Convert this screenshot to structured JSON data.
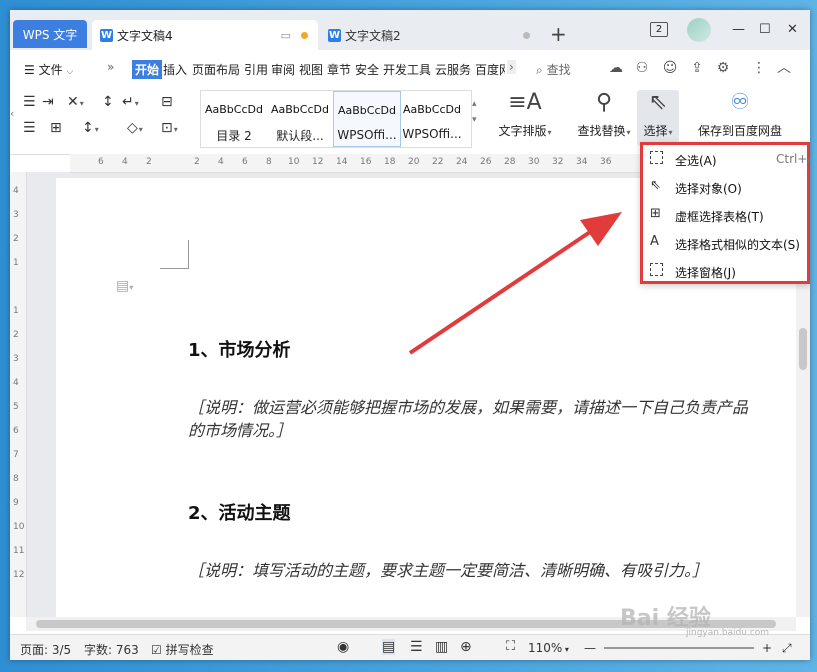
{
  "tabs": {
    "app": "WPS 文字",
    "active_doc": "文字文稿4",
    "inactive_doc": "文字文稿2",
    "add": "+",
    "window_badge": "2"
  },
  "menubar": {
    "file": "文件",
    "items": [
      "开始",
      "插入",
      "页面布局",
      "引用",
      "审阅",
      "视图",
      "章节",
      "安全",
      "开发工具",
      "云服务",
      "百度网"
    ],
    "active_item": "开始",
    "search": "查找"
  },
  "ribbon": {
    "styles": [
      {
        "sample": "AaBbCcDd",
        "name": "目录 2"
      },
      {
        "sample": "AaBbCcDd",
        "name": "默认段..."
      },
      {
        "sample": "AaBbCcDd",
        "name": "WPSOffi..."
      },
      {
        "sample": "AaBbCcDd",
        "name": "WPSOffi..."
      }
    ],
    "text_layout": "文字排版",
    "find_replace": "查找替换",
    "select": "选择",
    "save_baidu": "保存到百度网盘"
  },
  "select_menu": {
    "items": [
      {
        "label": "全选(A)",
        "shortcut": "Ctrl+A",
        "icon": "select-all-icon"
      },
      {
        "label": "选择对象(O)",
        "shortcut": "",
        "icon": "cursor-icon"
      },
      {
        "label": "虚框选择表格(T)",
        "shortcut": "",
        "icon": "table-select-icon"
      },
      {
        "label": "选择格式相似的文本(S)",
        "shortcut": "",
        "icon": "similar-format-icon"
      },
      {
        "label": "选择窗格(J)",
        "shortcut": "",
        "icon": "selection-pane-icon"
      }
    ]
  },
  "document": {
    "heading1": "1、市场分析",
    "note1_line1": "［说明：做运营必须能够把握市场的发展，如果需要，请描述一下自己负责产品",
    "note1_line2": "的市场情况。］",
    "heading2": "2、活动主题",
    "note2": "［说明：填写活动的主题，要求主题一定要简洁、清晰明确、有吸引力。］"
  },
  "status": {
    "page": "页面: 3/5",
    "words": "字数: 763",
    "spellcheck": "拼写检查",
    "zoom": "110%"
  },
  "watermark": {
    "text": "Bai 经验",
    "sub": "jingyan.baidu.com"
  },
  "colors": {
    "accent": "#3d7fe0",
    "highlight_box": "#e13b3b",
    "arrow": "#e13b3b"
  }
}
